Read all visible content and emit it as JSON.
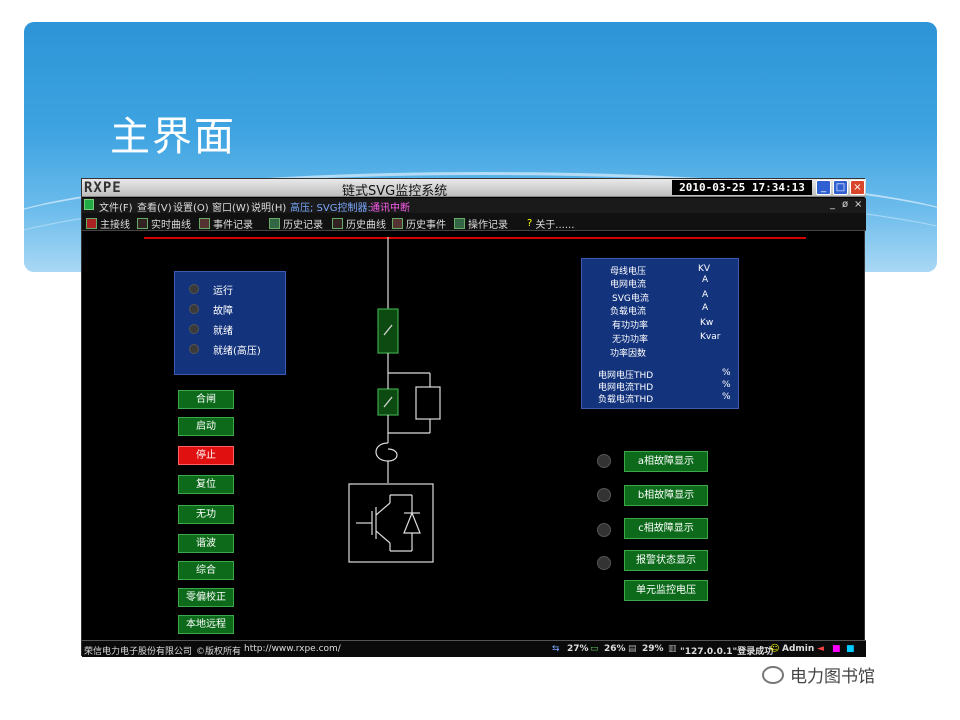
{
  "slide": {
    "title": "主界面"
  },
  "app": {
    "logo": "RXPE",
    "title": "链式SVG监控系统",
    "clock": "2010-03-25 17:34:13",
    "window_buttons": {
      "minimize": "_",
      "restore": "□",
      "close": "×"
    }
  },
  "menubar": {
    "items": [
      "文件(F)",
      "查看(V)",
      "设置(O)",
      "窗口(W)",
      "说明(H)"
    ],
    "status": "高压; SVG控制器:",
    "status_alert": "通讯中断",
    "mdi": {
      "minimize": "_",
      "restore": "ø",
      "close": "×"
    }
  },
  "toolbar": {
    "items": [
      "主接线",
      "实时曲线",
      "事件记录",
      "历史记录",
      "历史曲线",
      "历史事件",
      "操作记录",
      "关于......"
    ]
  },
  "status_panel": {
    "items": [
      "运行",
      "故障",
      "就绪",
      "就绪(高压)"
    ]
  },
  "controls": [
    "合闸",
    "启动",
    "停止",
    "复位",
    "无功",
    "谐波",
    "综合",
    "零偏校正",
    "本地远程"
  ],
  "measurements": {
    "rows": [
      {
        "label": "母线电压",
        "unit": "KV"
      },
      {
        "label": "电网电流",
        "unit": "A"
      },
      {
        "label": "SVG电流",
        "unit": "A"
      },
      {
        "label": "负载电流",
        "unit": "A"
      },
      {
        "label": "有功功率",
        "unit": "Kw"
      },
      {
        "label": "无功功率",
        "unit": "Kvar"
      },
      {
        "label": "功率因数",
        "unit": ""
      },
      {
        "label": "电网电压THD",
        "unit": "%"
      },
      {
        "label": "电网电流THD",
        "unit": "%"
      },
      {
        "label": "负载电流THD",
        "unit": "%"
      }
    ]
  },
  "fault_buttons": [
    "a相故障显示",
    "b相故障显示",
    "c相故障显示",
    "报警状态显示",
    "单元监控电压"
  ],
  "statusbar": {
    "company": "荣信电力电子股份有限公司",
    "rights": "©版权所有",
    "url": "http://www.rxpe.com/",
    "cpu": "27%",
    "mem": "26%",
    "disk": "29%",
    "login": "\"127.0.0.1\"登录成功",
    "user": "Admin"
  },
  "watermark": "电力图书馆",
  "colors": {
    "accent_blue": "#2d95d7",
    "panel_blue": "#13337d",
    "button_green": "#0c6a1a",
    "stop_red": "#e01010",
    "rail_red": "#d40000"
  }
}
